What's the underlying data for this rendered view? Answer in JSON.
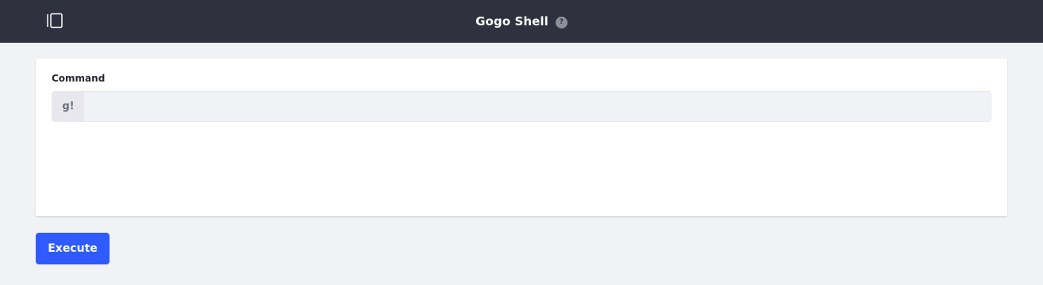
{
  "header": {
    "title": "Gogo Shell",
    "help_icon": "question-circle-icon",
    "help_glyph": "?",
    "toggle_icon": "sidebar-toggle-icon"
  },
  "form": {
    "command_label": "Command",
    "prefix": "g!",
    "command_value": "",
    "command_placeholder": ""
  },
  "actions": {
    "execute_label": "Execute"
  },
  "colors": {
    "header_bg": "#30313f",
    "page_bg": "#f1f2f5",
    "primary": "#2e5aff"
  }
}
